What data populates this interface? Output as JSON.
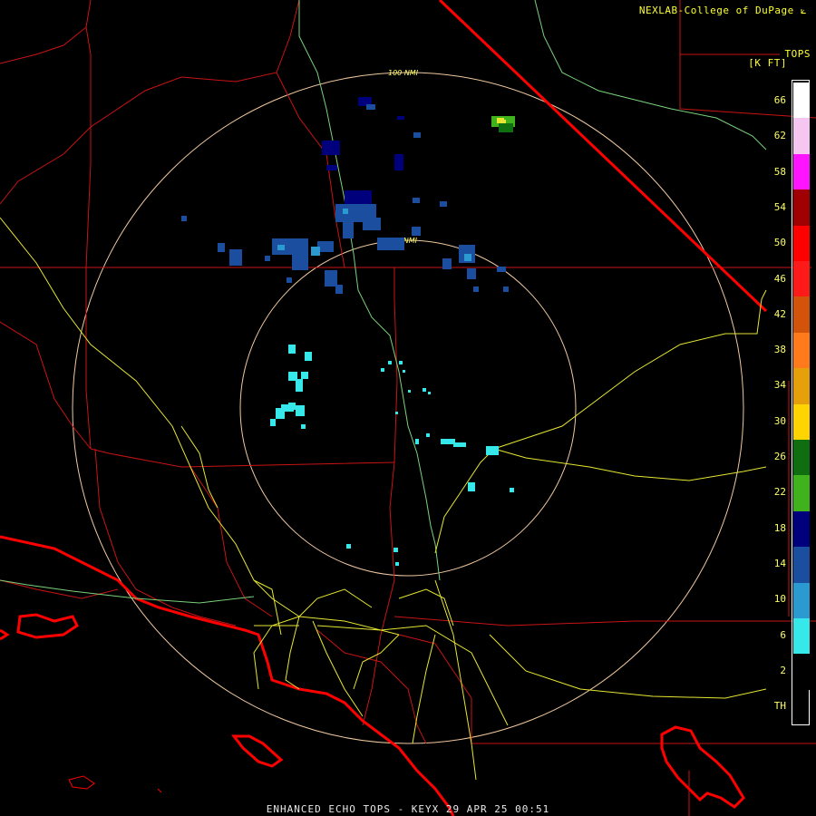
{
  "header": {
    "credit": "NEXLAB-College of DuPage",
    "logo_glyph": "⟀"
  },
  "legend": {
    "title": "TOPS",
    "units": "[K FT]",
    "labels": [
      "66",
      "62",
      "58",
      "54",
      "50",
      "46",
      "42",
      "38",
      "34",
      "30",
      "26",
      "22",
      "18",
      "14",
      "10",
      "6",
      "2",
      "TH"
    ],
    "colors": [
      "#ffffff",
      "#f4c6f0",
      "#ff14ff",
      "#a00000",
      "#ff0000",
      "#ff1a1a",
      "#d2540a",
      "#ff7a1a",
      "#e6a00a",
      "#ffd400",
      "#0f6e0f",
      "#3fb21c",
      "#00007c",
      "#1c4ea0",
      "#2a9ad0",
      "#37e8ea",
      "#000000"
    ]
  },
  "rings": [
    {
      "label": "100 NMI"
    },
    {
      "label": "50 NMI"
    }
  ],
  "footer": {
    "product": "ENHANCED ECHO TOPS - KEYX 29 APR 25 00:51"
  },
  "colors": {
    "county_border": "#c81414",
    "coastline": "#ff0000",
    "highway": "#e6e632",
    "river": "#7ad27a",
    "ring": "#f0c8a0",
    "echo_cyan": "#37e8ea",
    "echo_blue": "#1c4ea0",
    "echo_navy": "#00007c",
    "echo_green": "#3fb21c"
  }
}
